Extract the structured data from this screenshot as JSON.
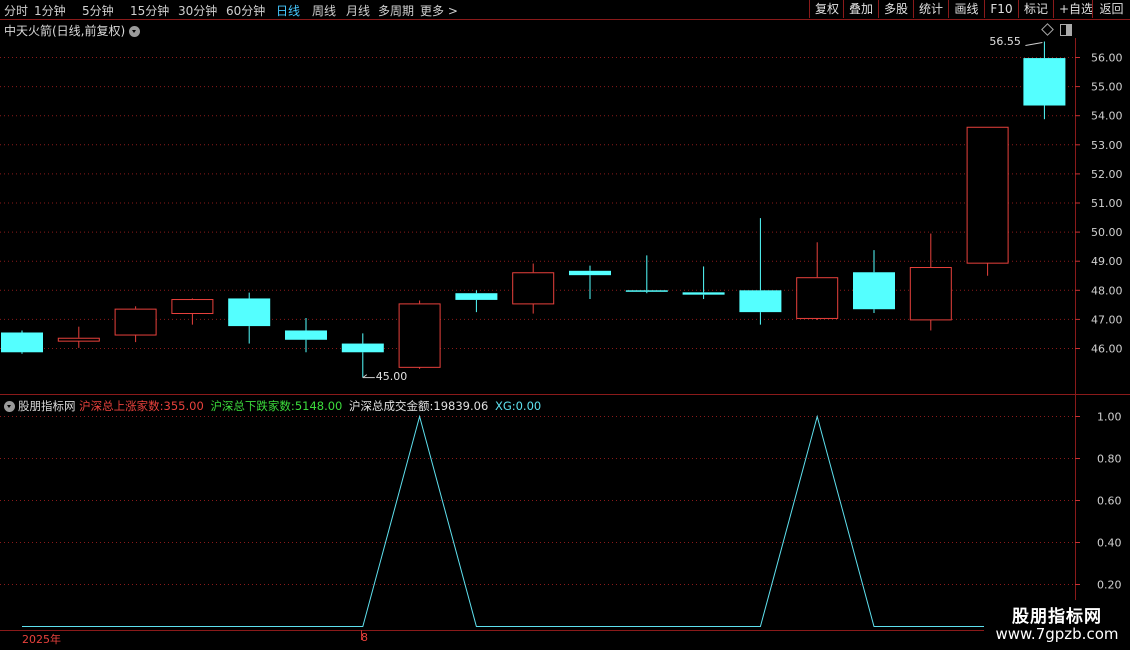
{
  "topbar": {
    "periods": [
      "分时",
      "1分钟",
      "5分钟",
      "15分钟",
      "30分钟",
      "60分钟",
      "日线",
      "周线",
      "月线",
      "多周期",
      "更多 >"
    ],
    "active_period": "日线",
    "right_buttons": [
      "复权",
      "叠加",
      "多股",
      "统计",
      "画线",
      "F10",
      "标记",
      "+自选",
      "返回"
    ]
  },
  "main_chart": {
    "title": "中天火箭(日线,前复权)",
    "high_label": "56.55",
    "low_label": "45.00",
    "up_color": "#e8413c",
    "down_color": "#54ffff",
    "candles": [
      {
        "o": 46.55,
        "h": 46.62,
        "l": 45.82,
        "c": 45.87
      },
      {
        "o": 46.27,
        "h": 46.75,
        "l": 46.02,
        "c": 46.37
      },
      {
        "o": 46.48,
        "h": 47.45,
        "l": 46.22,
        "c": 47.37
      },
      {
        "o": 47.22,
        "h": 47.72,
        "l": 46.82,
        "c": 47.7
      },
      {
        "o": 47.72,
        "h": 47.92,
        "l": 46.17,
        "c": 46.77
      },
      {
        "o": 46.62,
        "h": 47.05,
        "l": 45.87,
        "c": 46.3
      },
      {
        "o": 46.17,
        "h": 46.52,
        "l": 45.0,
        "c": 45.87
      },
      {
        "o": 45.37,
        "h": 47.65,
        "l": 45.3,
        "c": 47.55
      },
      {
        "o": 47.9,
        "h": 48.0,
        "l": 47.25,
        "c": 47.67
      },
      {
        "o": 47.55,
        "h": 48.92,
        "l": 47.2,
        "c": 48.62
      },
      {
        "o": 48.67,
        "h": 48.85,
        "l": 47.7,
        "c": 48.52
      },
      {
        "o": 48.0,
        "h": 49.2,
        "l": 47.9,
        "c": 47.95
      },
      {
        "o": 47.93,
        "h": 48.82,
        "l": 47.7,
        "c": 47.85
      },
      {
        "o": 48.0,
        "h": 50.48,
        "l": 46.82,
        "c": 47.25
      },
      {
        "o": 47.05,
        "h": 49.65,
        "l": 46.98,
        "c": 48.45
      },
      {
        "o": 48.62,
        "h": 49.38,
        "l": 47.22,
        "c": 47.35
      },
      {
        "o": 47.0,
        "h": 49.95,
        "l": 46.62,
        "c": 48.8
      },
      {
        "o": 48.95,
        "h": 53.62,
        "l": 48.5,
        "c": 53.62
      },
      {
        "o": 55.98,
        "h": 56.55,
        "l": 53.88,
        "c": 54.35
      }
    ],
    "y_ticks": [
      "56.00",
      "55.00",
      "54.00",
      "53.00",
      "52.00",
      "51.00",
      "50.00",
      "49.00",
      "48.00",
      "47.00",
      "46.00"
    ]
  },
  "indicator": {
    "name": "股朋指标网",
    "up_label": "沪深总上涨家数:",
    "up_value": "355.00",
    "down_label": "沪深总下跌家数:",
    "down_value": "5148.00",
    "amount_label": "沪深总成交金额:",
    "amount_value": "19839.06",
    "xg_label": "XG:",
    "xg_value": "0.00",
    "xg_values": [
      0,
      0,
      0,
      0,
      0,
      0,
      0,
      1,
      0,
      0,
      0,
      0,
      0,
      0,
      1,
      0,
      0,
      0,
      0
    ],
    "y_ticks": [
      "1.00",
      "0.80",
      "0.60",
      "0.40",
      "0.20"
    ],
    "line_color": "#5ee0ee"
  },
  "bottom_axis": {
    "year_label": "2025年",
    "month_label": "8"
  },
  "watermark": {
    "line1": "股朋指标网",
    "line2": "www.7gpzb.com"
  }
}
